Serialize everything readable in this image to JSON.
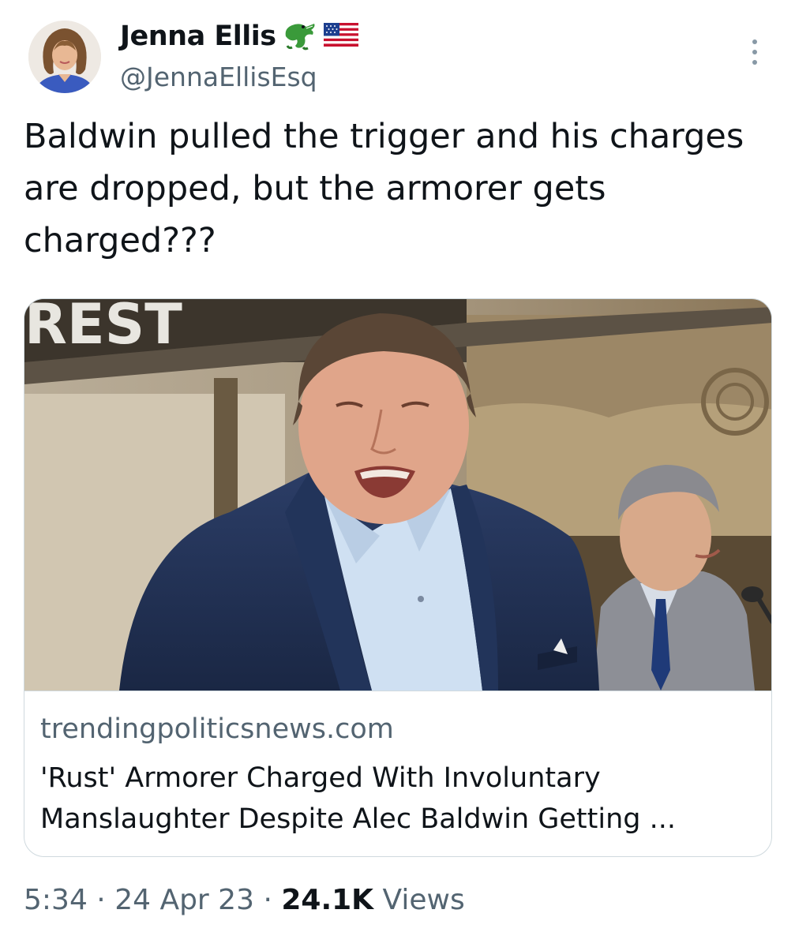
{
  "author": {
    "display_name": "Jenna Ellis",
    "handle": "@JennaEllisEsq",
    "badges": [
      "alligator-emoji",
      "us-flag-emoji"
    ]
  },
  "tweet": {
    "text": "Baldwin pulled the trigger and his charges are dropped, but the armorer gets charged???"
  },
  "link_card": {
    "domain": "trendingpoliticsnews.com",
    "title": "'Rust' Armorer Charged With Involuntary Manslaughter Despite Alec Baldwin Getting ...",
    "photo_sign_text": "REST"
  },
  "meta": {
    "time": "5:34",
    "separator": "·",
    "date": "24 Apr 23",
    "views_count": "24.1K",
    "views_label": "Views"
  },
  "colors": {
    "text_primary": "#0f1419",
    "text_secondary": "#536471",
    "border": "#cfd9de"
  }
}
